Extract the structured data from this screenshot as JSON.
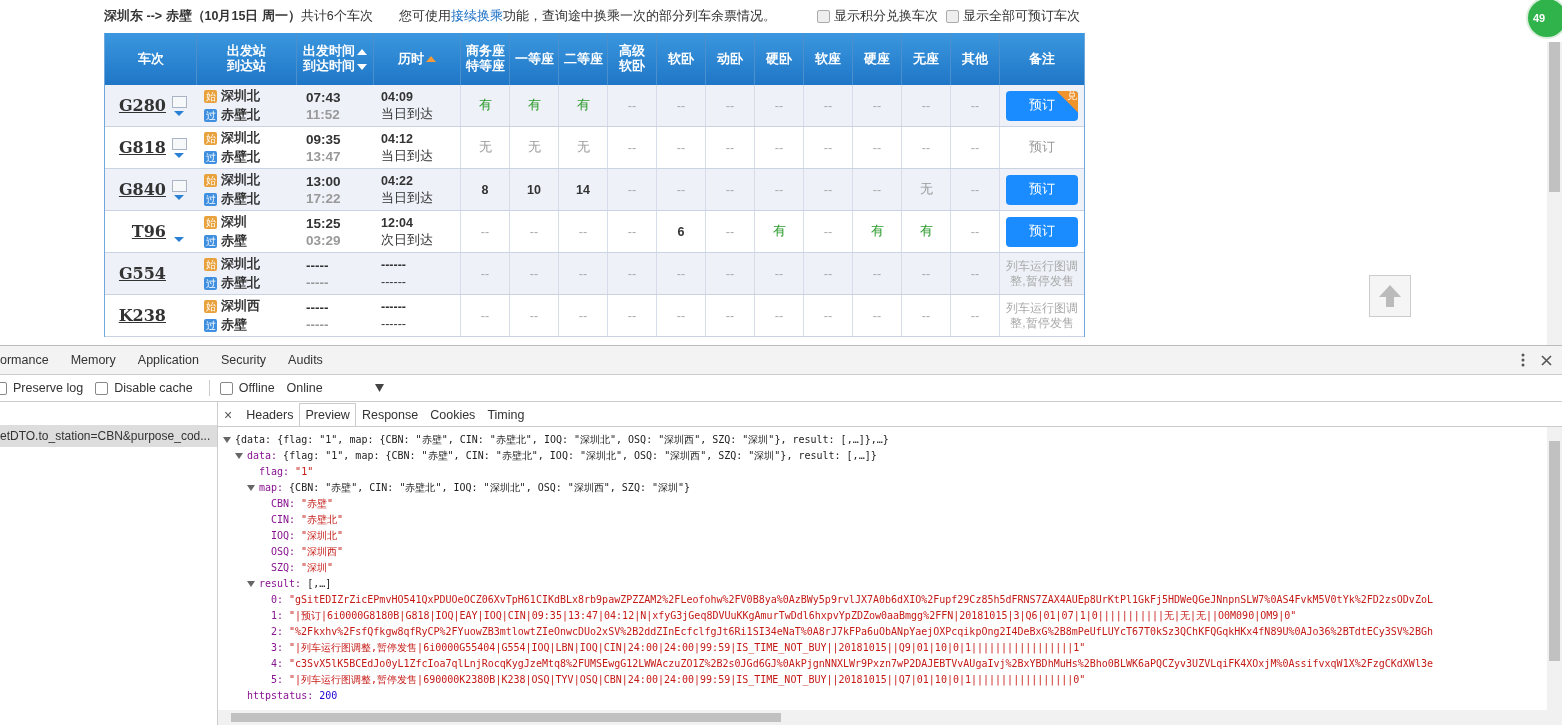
{
  "page": {
    "summary": "**深圳东 --> 赤壁（10月15日  周一）**共计6个车次",
    "notice": {
      "before": "您可使用",
      "link": "接续换乘",
      "after": "功能，查询途中换乘一次的部分列车余票情况。"
    },
    "filters": [
      {
        "label": "显示积分兑换车次",
        "checked": false
      },
      {
        "label": "显示全部可预订车次",
        "checked": false
      }
    ],
    "badge": "49",
    "columns": [
      {
        "lines": [
          {
            "text": "车次"
          }
        ]
      },
      {
        "lines": [
          {
            "text": "出发站"
          },
          {
            "text": "到达站"
          }
        ]
      },
      {
        "lines": [
          {
            "text": "出发时间",
            "arrow_up": true,
            "active": false
          },
          {
            "text": "到达时间",
            "arrow_down": true,
            "active": false
          }
        ]
      },
      {
        "lines": [
          {
            "text": "历时",
            "arrow_up": true,
            "active": true
          }
        ]
      },
      {
        "lines": [
          {
            "text": "商务座"
          },
          {
            "text": "特等座"
          }
        ]
      },
      {
        "lines": [
          {
            "text": "一等座"
          }
        ]
      },
      {
        "lines": [
          {
            "text": "二等座"
          }
        ]
      },
      {
        "lines": [
          {
            "text": "高级"
          },
          {
            "text": "软卧"
          }
        ]
      },
      {
        "lines": [
          {
            "text": "软卧"
          }
        ]
      },
      {
        "lines": [
          {
            "text": "动卧"
          }
        ]
      },
      {
        "lines": [
          {
            "text": "硬卧"
          }
        ]
      },
      {
        "lines": [
          {
            "text": "软座"
          }
        ]
      },
      {
        "lines": [
          {
            "text": "硬座"
          }
        ]
      },
      {
        "lines": [
          {
            "text": "无座"
          }
        ]
      },
      {
        "lines": [
          {
            "text": "其他"
          }
        ]
      },
      {
        "lines": [
          {
            "text": "备注"
          }
        ]
      }
    ],
    "trains": [
      {
        "code": "G280",
        "info_icon": true,
        "expand_icon": true,
        "from_tag": "始",
        "from": "深圳北",
        "to_tag": "过",
        "to": "赤壁北",
        "depart": "07:43",
        "arrive": "11:52",
        "duration": "04:09",
        "arrival_day": "当日到达",
        "seats": [
          {
            "kind": "yes",
            "text": "有"
          },
          {
            "kind": "yes",
            "text": "有"
          },
          {
            "kind": "yes",
            "text": "有"
          },
          {
            "kind": "na",
            "text": "--"
          },
          {
            "kind": "na",
            "text": "--"
          },
          {
            "kind": "na",
            "text": "--"
          },
          {
            "kind": "na",
            "text": "--"
          },
          {
            "kind": "na",
            "text": "--"
          },
          {
            "kind": "na",
            "text": "--"
          },
          {
            "kind": "na",
            "text": "--"
          },
          {
            "kind": "na",
            "text": "--"
          }
        ],
        "remark": {
          "kind": "button",
          "text": "预订",
          "corner": "兑"
        }
      },
      {
        "code": "G818",
        "info_icon": true,
        "expand_icon": true,
        "from_tag": "始",
        "from": "深圳北",
        "to_tag": "过",
        "to": "赤壁北",
        "depart": "09:35",
        "arrive": "13:47",
        "duration": "04:12",
        "arrival_day": "当日到达",
        "seats": [
          {
            "kind": "no",
            "text": "无"
          },
          {
            "kind": "no",
            "text": "无"
          },
          {
            "kind": "no",
            "text": "无"
          },
          {
            "kind": "na",
            "text": "--"
          },
          {
            "kind": "na",
            "text": "--"
          },
          {
            "kind": "na",
            "text": "--"
          },
          {
            "kind": "na",
            "text": "--"
          },
          {
            "kind": "na",
            "text": "--"
          },
          {
            "kind": "na",
            "text": "--"
          },
          {
            "kind": "na",
            "text": "--"
          },
          {
            "kind": "na",
            "text": "--"
          }
        ],
        "remark": {
          "kind": "disabled",
          "text": "预订"
        }
      },
      {
        "code": "G840",
        "info_icon": true,
        "expand_icon": true,
        "from_tag": "始",
        "from": "深圳北",
        "to_tag": "过",
        "to": "赤壁北",
        "depart": "13:00",
        "arrive": "17:22",
        "duration": "04:22",
        "arrival_day": "当日到达",
        "seats": [
          {
            "kind": "count",
            "text": "8"
          },
          {
            "kind": "count",
            "text": "10"
          },
          {
            "kind": "count",
            "text": "14"
          },
          {
            "kind": "na",
            "text": "--"
          },
          {
            "kind": "na",
            "text": "--"
          },
          {
            "kind": "na",
            "text": "--"
          },
          {
            "kind": "na",
            "text": "--"
          },
          {
            "kind": "na",
            "text": "--"
          },
          {
            "kind": "na",
            "text": "--"
          },
          {
            "kind": "no",
            "text": "无"
          },
          {
            "kind": "na",
            "text": "--"
          }
        ],
        "remark": {
          "kind": "button",
          "text": "预订"
        }
      },
      {
        "code": "T96",
        "info_icon": false,
        "expand_icon": true,
        "from_tag": "始",
        "from": "深圳",
        "to_tag": "过",
        "to": "赤壁",
        "depart": "15:25",
        "arrive": "03:29",
        "duration": "12:04",
        "arrival_day": "次日到达",
        "seats": [
          {
            "kind": "na",
            "text": "--"
          },
          {
            "kind": "na",
            "text": "--"
          },
          {
            "kind": "na",
            "text": "--"
          },
          {
            "kind": "na",
            "text": "--"
          },
          {
            "kind": "count",
            "text": "6"
          },
          {
            "kind": "na",
            "text": "--"
          },
          {
            "kind": "yes",
            "text": "有"
          },
          {
            "kind": "na",
            "text": "--"
          },
          {
            "kind": "yes",
            "text": "有"
          },
          {
            "kind": "yes",
            "text": "有"
          },
          {
            "kind": "na",
            "text": "--"
          }
        ],
        "remark": {
          "kind": "button",
          "text": "预订"
        }
      },
      {
        "code": "G554",
        "info_icon": false,
        "expand_icon": false,
        "from_tag": "始",
        "from": "深圳北",
        "to_tag": "过",
        "to": "赤壁北",
        "depart": "-----",
        "arrive": "-----",
        "duration": "------",
        "arrival_day": "------",
        "seats": [
          {
            "kind": "na",
            "text": "--"
          },
          {
            "kind": "na",
            "text": "--"
          },
          {
            "kind": "na",
            "text": "--"
          },
          {
            "kind": "na",
            "text": "--"
          },
          {
            "kind": "na",
            "text": "--"
          },
          {
            "kind": "na",
            "text": "--"
          },
          {
            "kind": "na",
            "text": "--"
          },
          {
            "kind": "na",
            "text": "--"
          },
          {
            "kind": "na",
            "text": "--"
          },
          {
            "kind": "na",
            "text": "--"
          },
          {
            "kind": "na",
            "text": "--"
          }
        ],
        "remark": {
          "kind": "note",
          "text": "列车运行图调整,暂停发售"
        }
      },
      {
        "code": "K238",
        "info_icon": false,
        "expand_icon": false,
        "from_tag": "始",
        "from": "深圳西",
        "to_tag": "过",
        "to": "赤壁",
        "depart": "-----",
        "arrive": "-----",
        "duration": "------",
        "arrival_day": "------",
        "seats": [
          {
            "kind": "na",
            "text": "--"
          },
          {
            "kind": "na",
            "text": "--"
          },
          {
            "kind": "na",
            "text": "--"
          },
          {
            "kind": "na",
            "text": "--"
          },
          {
            "kind": "na",
            "text": "--"
          },
          {
            "kind": "na",
            "text": "--"
          },
          {
            "kind": "na",
            "text": "--"
          },
          {
            "kind": "na",
            "text": "--"
          },
          {
            "kind": "na",
            "text": "--"
          },
          {
            "kind": "na",
            "text": "--"
          },
          {
            "kind": "na",
            "text": "--"
          }
        ],
        "remark": {
          "kind": "note",
          "text": "列车运行图调整,暂停发售"
        }
      }
    ]
  },
  "devtools": {
    "panels": [
      {
        "label": "ormance"
      },
      {
        "label": "Memory"
      },
      {
        "label": "Application"
      },
      {
        "label": "Security"
      },
      {
        "label": "Audits"
      }
    ],
    "options": [
      {
        "label": "Preserve log",
        "checked": false
      },
      {
        "label": "Disable cache",
        "checked": false
      },
      {
        "label": "Offline",
        "checked": false
      }
    ],
    "throttle": "Online",
    "requests": [
      {
        "name": "etDTO.to_station=CBN&purpose_cod...",
        "selected": true
      }
    ],
    "detail_close": "×",
    "detail_tabs": [
      {
        "label": "Headers",
        "selected": false
      },
      {
        "label": "Preview",
        "selected": true
      },
      {
        "label": "Response",
        "selected": false
      },
      {
        "label": "Cookies",
        "selected": false
      },
      {
        "label": "Timing",
        "selected": false
      }
    ],
    "preview": {
      "summary": "{data: {flag: \"1\", map: {CBN: \"赤壁\", CIN: \"赤壁北\", IOQ: \"深圳北\", OSQ: \"深圳西\", SZQ: \"深圳\"}, result: [,…]},…}",
      "expanded": true,
      "children": [
        {
          "key": "data:",
          "summary": "{flag: \"1\", map: {CBN: \"赤壁\", CIN: \"赤壁北\", IOQ: \"深圳北\", OSQ: \"深圳西\", SZQ: \"深圳\"}, result: [,…]}",
          "expanded": true,
          "children": [
            {
              "key": "flag:",
              "value": "\"1\"",
              "kind": "string"
            },
            {
              "key": "map:",
              "summary": "{CBN: \"赤壁\", CIN: \"赤壁北\", IOQ: \"深圳北\", OSQ: \"深圳西\", SZQ: \"深圳\"}",
              "expanded": true,
              "children": [
                {
                  "key": "CBN:",
                  "value": "\"赤壁\"",
                  "kind": "string"
                },
                {
                  "key": "CIN:",
                  "value": "\"赤壁北\"",
                  "kind": "string"
                },
                {
                  "key": "IOQ:",
                  "value": "\"深圳北\"",
                  "kind": "string"
                },
                {
                  "key": "OSQ:",
                  "value": "\"深圳西\"",
                  "kind": "string"
                },
                {
                  "key": "SZQ:",
                  "value": "\"深圳\"",
                  "kind": "string"
                }
              ]
            },
            {
              "key": "result:",
              "summary": "[,…]",
              "expanded": true,
              "children": [
                {
                  "key": "0:",
                  "value": "\"gSitEDIZrZicEPmvHO541QxPDUOeOCZ06XvTpH61CIKdBLx8rb9pawZPZZAM2%2FLeofohw%2FV0B8ya%0AzBWy5p9rvlJX7A0b6dXIO%2Fupf29Cz85h5dFRNS7ZAX4AUEp8UrKtPl1GkFj5HDWeQGeJNnpnSLW7%0AS4FvkM5V0tYk%2FD2zsODvZoL",
                  "kind": "string"
                },
                {
                  "key": "1:",
                  "value": "\"|预订|6i0000G8180B|G818|IOQ|EAY|IOQ|CIN|09:35|13:47|04:12|N|xfyG3jGeq8DVUuKKgAmurTwDdl6hxpvYpZDZow0aaBmgg%2FFN|20181015|3|Q6|01|07|1|0|||||||||||无|无|无||O0M090|OM9|0\"",
                  "kind": "string"
                },
                {
                  "key": "2:",
                  "value": "\"%2Fkxhv%2FsfQfkgw8qfRyCP%2FYuowZB3mtlowtZIeOnwcDUo2xSV%2B2ddZInEcfclfgJt6Ri1SI34eNaT%0A8rJ7kFPa6uObANpYaejOXPcqikpOng2I4DeBxG%2B8mPeUfLUYcT67T0kSz3QChKFQGqkHKx4fN89U%0AJo36%2BTdtECy3SV%2BGh",
                  "kind": "string"
                },
                {
                  "key": "3:",
                  "value": "\"|列车运行图调整,暂停发售|6i0000G55404|G554|IOQ|LBN|IOQ|CIN|24:00|24:00|99:59|IS_TIME_NOT_BUY||20181015||Q9|01|10|0|1|||||||||||||||||1\"",
                  "kind": "string"
                },
                {
                  "key": "4:",
                  "value": "\"c3SvX5lK5BCEdJo0yL1ZfcIoa7qlLnjRocqKygJzeMtq8%2FUMSEwgG12LWWAczuZO1Z%2B2s0JGd6GJ%0AkPjgnNNXLWr9Pxzn7wP2DAJEBTVvAUgaIvj%2BxYBDhMuHs%2Bho0BLWK6aPQCZyv3UZVLqiFK4XOxjM%0AssifvxqW1X%2FzgCKdXWl3e",
                  "kind": "string"
                },
                {
                  "key": "5:",
                  "value": "\"|列车运行图调整,暂停发售|690000K2380B|K238|OSQ|TYV|OSQ|CBN|24:00|24:00|99:59|IS_TIME_NOT_BUY||20181015||Q7|01|10|0|1|||||||||||||||||0\"",
                  "kind": "string"
                }
              ]
            }
          ]
        },
        {
          "key": "httpstatus:",
          "value": "200",
          "kind": "number"
        }
      ]
    }
  }
}
